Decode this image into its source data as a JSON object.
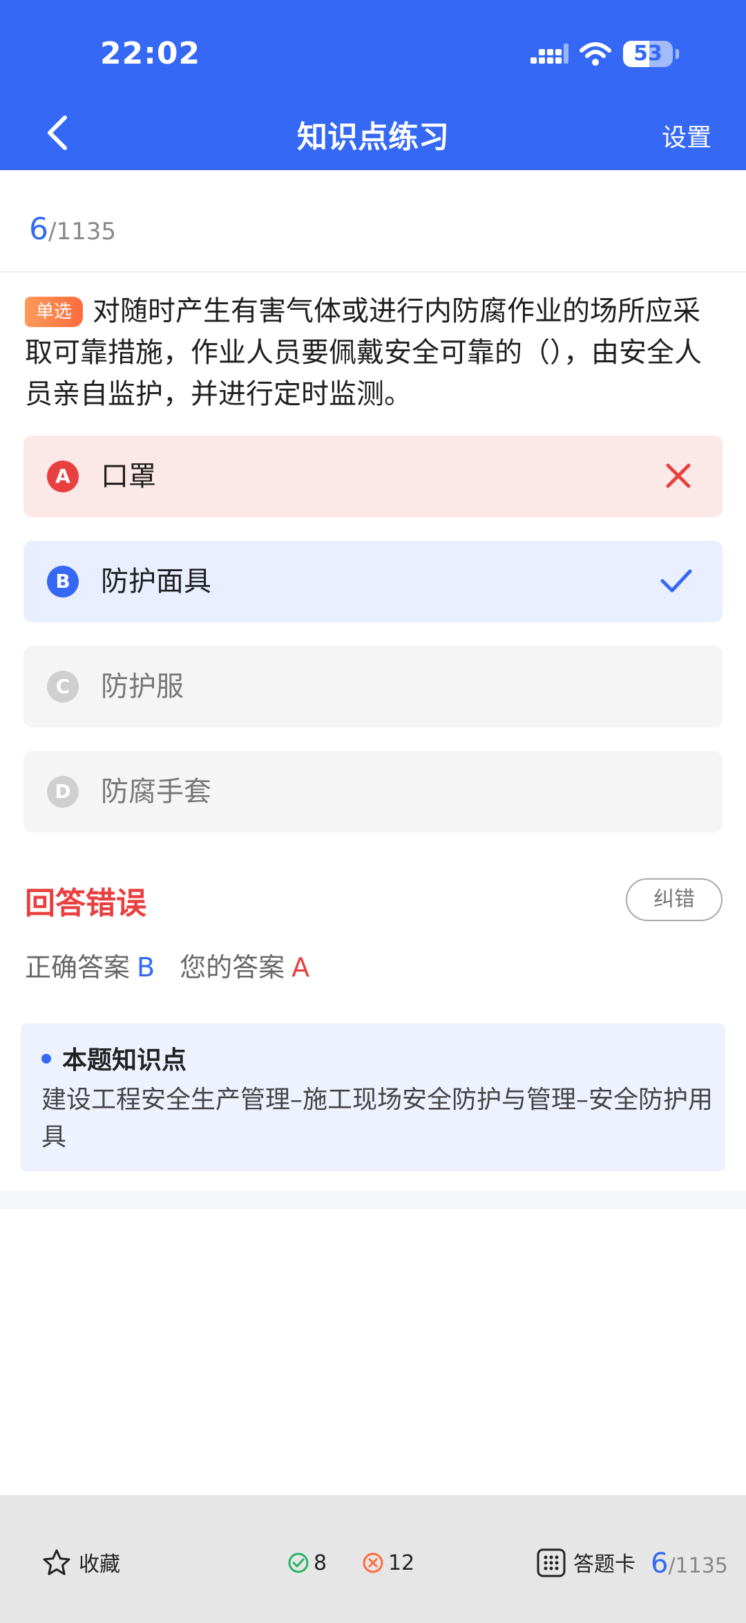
{
  "status_bar": {
    "time": "22:02",
    "battery": "53",
    "battery_level": 0.53
  },
  "nav": {
    "title": "知识点练习",
    "right_label": "设置"
  },
  "progress": {
    "current": "6",
    "total": "/1135"
  },
  "question": {
    "badge": "单选",
    "text": "对随时产生有害气体或进行内防腐作业的场所应采取可靠措施，作业人员要佩戴安全可靠的（），由安全人员亲自监护，并进行定时监测。"
  },
  "options": [
    {
      "letter": "A",
      "text": "口罩",
      "state": "wrong"
    },
    {
      "letter": "B",
      "text": "防护面具",
      "state": "correct"
    },
    {
      "letter": "C",
      "text": "防护服",
      "state": "none"
    },
    {
      "letter": "D",
      "text": "防腐手套",
      "state": "none"
    }
  ],
  "result": {
    "title": "回答错误",
    "report_label": "纠错",
    "correct_label": "正确答案",
    "correct_value": "B",
    "your_label": "您的答案",
    "your_value": "A"
  },
  "knowledge": {
    "title": "本题知识点",
    "text": "建设工程安全生产管理–施工现场安全防护与管理–安全防护用具"
  },
  "bottom_bar": {
    "favorite_label": "收藏",
    "correct_count": "8",
    "wrong_count": "12",
    "card_label": "答题卡",
    "progress_current": "6",
    "progress_total": "/1135"
  },
  "colors": {
    "primary": "#3468f5",
    "error": "#e8403f",
    "badge": "#ff7a45",
    "correct_icon": "#27b36a"
  }
}
